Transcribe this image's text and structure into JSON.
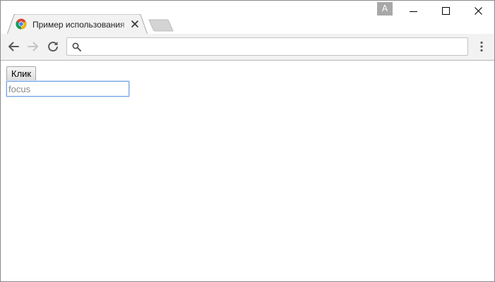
{
  "window": {
    "profile_badge": "A"
  },
  "tab": {
    "title": "Пример использования",
    "favicon": "chrome-favicon-icon",
    "close_icon": "close-icon"
  },
  "toolbar": {
    "back_icon": "arrow-back-icon",
    "forward_icon": "arrow-forward-icon",
    "reload_icon": "reload-icon",
    "omnibox_icon": "search-icon",
    "omnibox_value": "",
    "menu_icon": "more-vertical-icon"
  },
  "page": {
    "button_label": "Клик",
    "input_placeholder": "focus",
    "input_value": ""
  },
  "colors": {
    "toolbar_bg": "#f2f2f2",
    "focus_ring": "#7aa7e3",
    "profile_badge_bg": "#a8a8a8"
  }
}
